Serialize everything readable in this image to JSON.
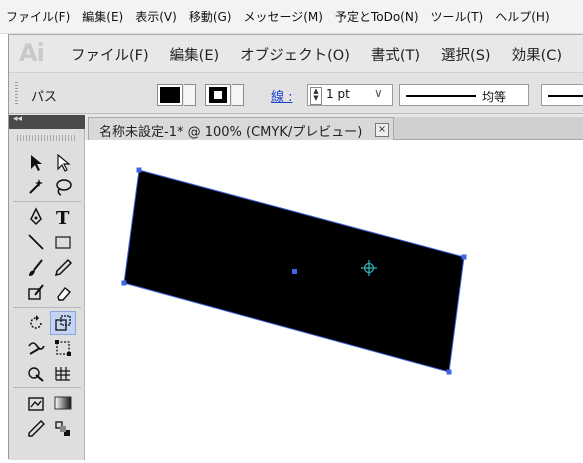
{
  "outer_menu": {
    "items": [
      "ファイル(F)",
      "編集(E)",
      "表示(V)",
      "移動(G)",
      "メッセージ(M)",
      "予定とToDo(N)",
      "ツール(T)",
      "ヘルプ(H)"
    ]
  },
  "app": {
    "logo": "Ai",
    "menu": [
      "ファイル(F)",
      "編集(E)",
      "オブジェクト(O)",
      "書式(T)",
      "選択(S)",
      "効果(C)"
    ]
  },
  "control_bar": {
    "selection_label": "パス",
    "stroke_label": "線 :",
    "stroke_weight": "1 pt",
    "stroke_profile": "均等",
    "fill_color": "#000000",
    "stroke_color": "#000000"
  },
  "document": {
    "tab_title": "名称未設定-1* @ 100% (CMYK/プレビュー)",
    "close_glyph": "×"
  },
  "tools": [
    {
      "name": "selection-tool-icon"
    },
    {
      "name": "direct-selection-tool-icon"
    },
    {
      "name": "magic-wand-tool-icon"
    },
    {
      "name": "lasso-tool-icon"
    },
    {
      "name": "pen-tool-icon"
    },
    {
      "name": "type-tool-icon"
    },
    {
      "name": "line-tool-icon"
    },
    {
      "name": "rectangle-tool-icon"
    },
    {
      "name": "paintbrush-tool-icon"
    },
    {
      "name": "pencil-tool-icon"
    },
    {
      "name": "blob-brush-tool-icon"
    },
    {
      "name": "eraser-tool-icon"
    },
    {
      "name": "rotate-tool-icon"
    },
    {
      "name": "scale-tool-icon",
      "active": true
    },
    {
      "name": "warp-tool-icon"
    },
    {
      "name": "free-transform-tool-icon"
    },
    {
      "name": "shape-builder-tool-icon"
    },
    {
      "name": "perspective-grid-tool-icon"
    },
    {
      "name": "symbol-sprayer-tool-icon"
    },
    {
      "name": "graph-tool-icon"
    },
    {
      "name": "mesh-tool-icon"
    },
    {
      "name": "gradient-tool-icon"
    },
    {
      "name": "eyedropper-tool-icon"
    },
    {
      "name": "blend-tool-icon"
    }
  ],
  "artwork": {
    "shape_fill": "#000000",
    "selection_color": "#3f66e0",
    "reference_point_color": "#2ab0b0"
  }
}
